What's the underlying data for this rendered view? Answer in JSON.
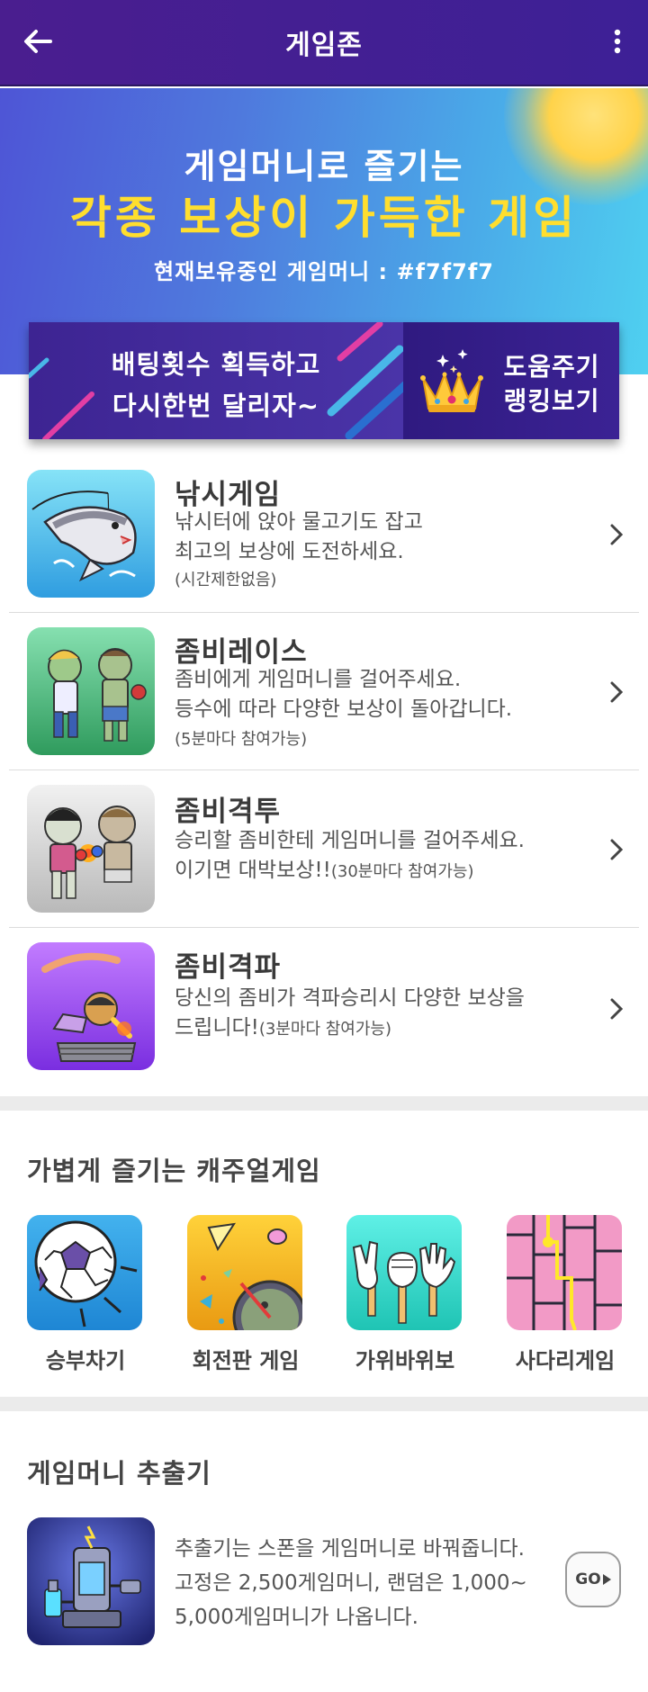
{
  "header": {
    "title": "게임존"
  },
  "hero": {
    "line1": "게임머니로 즐기는",
    "line2": "각종 보상이 가득한 게임",
    "line3": "현재보유중인 게임머니 : #f7f7f7"
  },
  "banner": {
    "left_line1": "배팅횟수 획득하고",
    "left_line2": "다시한번 달리자~",
    "right_line1": "도움주기",
    "right_line2": "랭킹보기"
  },
  "games": [
    {
      "title": "낚시게임",
      "desc1": "낚시터에 앉아 물고기도 잡고",
      "desc2": "최고의 보상에 도전하세요.",
      "note": "(시간제한없음)"
    },
    {
      "title": "좀비레이스",
      "desc1": "좀비에게 게임머니를 걸어주세요.",
      "desc2": "등수에 따라 다양한 보상이 돌아갑니다.",
      "note": "(5분마다 참여가능)"
    },
    {
      "title": "좀비격투",
      "desc1": "승리할 좀비한테 게임머니를 걸어주세요.",
      "desc2": "이기면 대박보상!!",
      "note": "(30분마다 참여가능)"
    },
    {
      "title": "좀비격파",
      "desc1": "당신의 좀비가 격파승리시 다양한 보상을",
      "desc2": "드립니다!",
      "note": "(3분마다 참여가능)"
    }
  ],
  "casual": {
    "section_title": "가볍게 즐기는 캐주얼게임",
    "items": [
      {
        "label": "승부차기"
      },
      {
        "label": "회전판 게임"
      },
      {
        "label": "가위바위보"
      },
      {
        "label": "사다리게임"
      }
    ]
  },
  "extractor": {
    "section_title": "게임머니 추출기",
    "line1": "추출기는 스폰을 게임머니로 바꿔줍니다.",
    "line2": "고정은 2,500게임머니, 랜덤은 1,000~",
    "line3": "5,000게임머니가 나옵니다.",
    "go_label": "GO"
  }
}
